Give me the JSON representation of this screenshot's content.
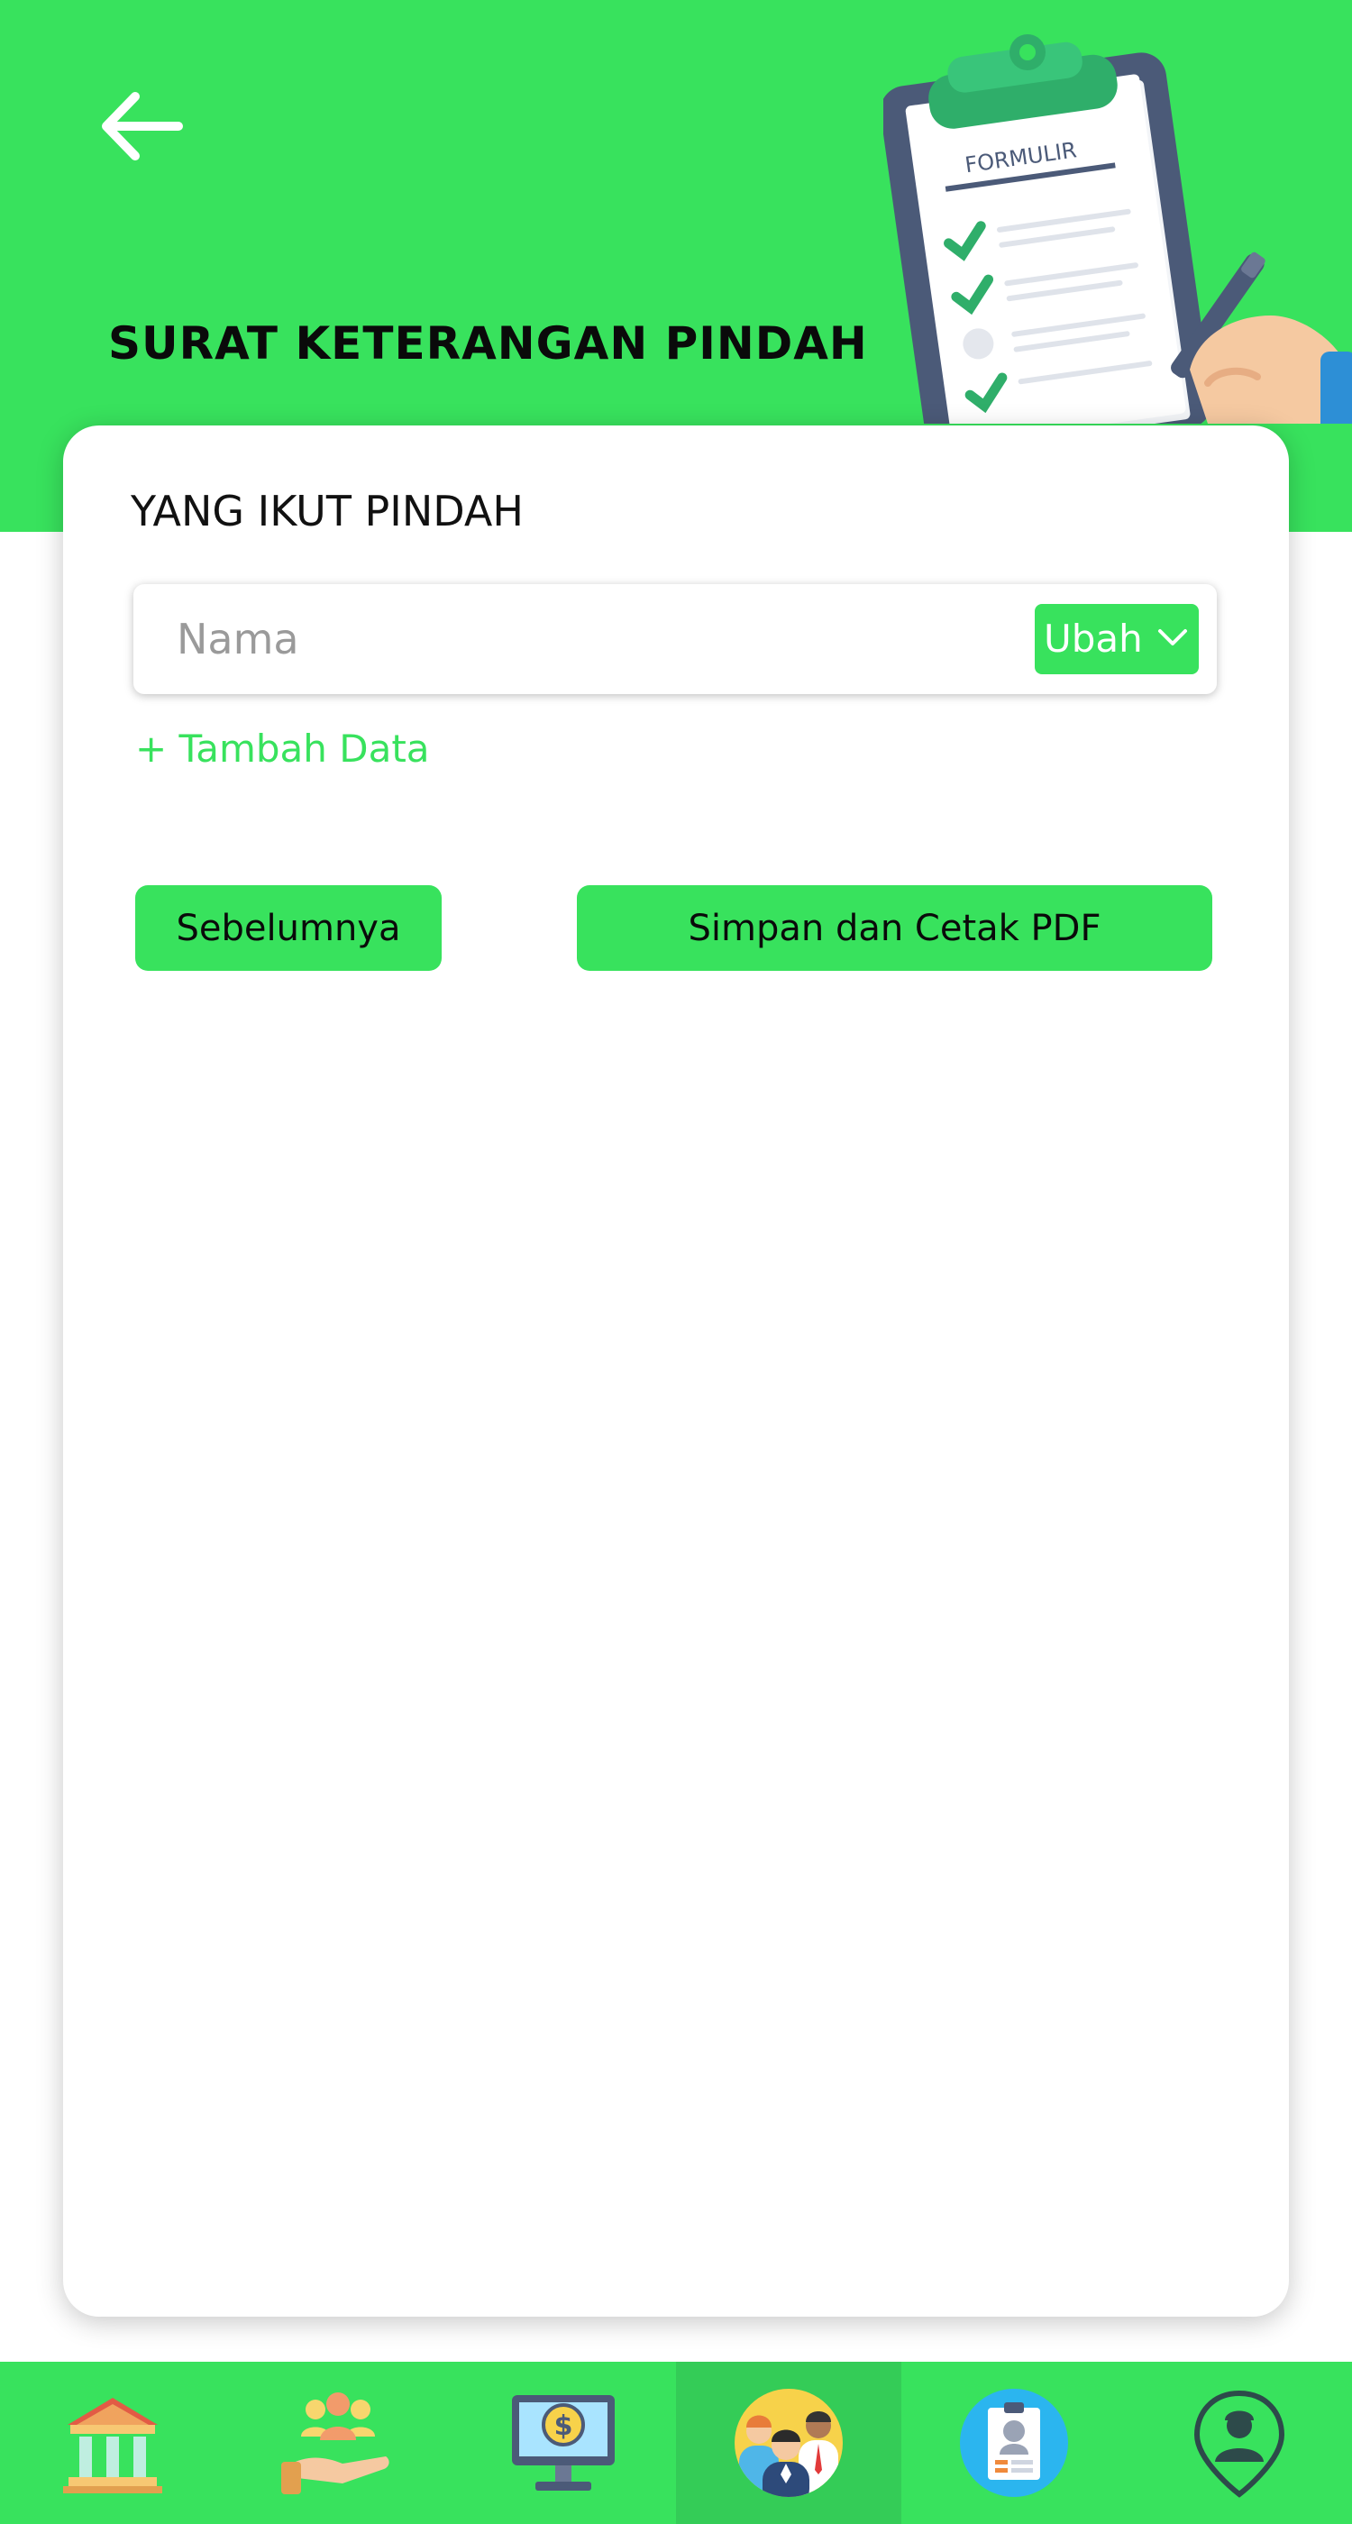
{
  "header": {
    "title": "SURAT KETERANGAN PINDAH",
    "illustration_text": "FORMULIR",
    "back_icon": "arrow-left-icon",
    "background_color": "#38e25d"
  },
  "form": {
    "section_label": "YANG IKUT PINDAH",
    "name_placeholder": "Nama",
    "name_value": "",
    "select_label": "Ubah",
    "add_label": "+ Tambah Data"
  },
  "actions": {
    "previous_label": "Sebelumnya",
    "save_label": "Simpan dan Cetak PDF"
  },
  "bottom_nav": {
    "items": [
      {
        "icon": "government-building-icon",
        "active": false
      },
      {
        "icon": "social-aid-icon",
        "active": false
      },
      {
        "icon": "finance-monitor-icon",
        "active": false
      },
      {
        "icon": "residents-group-icon",
        "active": true
      },
      {
        "icon": "id-card-icon",
        "active": false
      },
      {
        "icon": "profile-location-icon",
        "active": false
      }
    ]
  },
  "colors": {
    "accent": "#38e25d",
    "accent_dark": "#34cc57",
    "text": "#0a0a0a"
  }
}
